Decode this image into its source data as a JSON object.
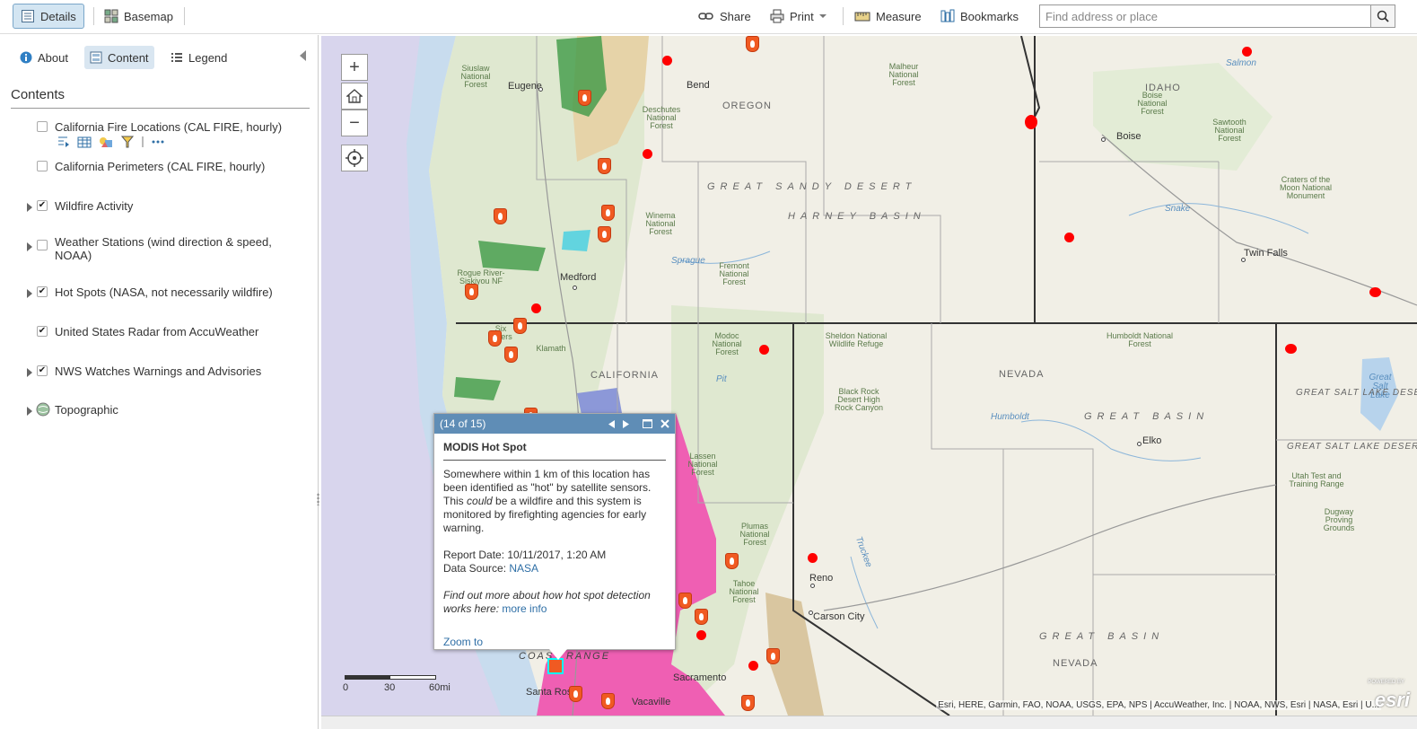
{
  "toolbar": {
    "details_label": "Details",
    "basemap_label": "Basemap",
    "share_label": "Share",
    "print_label": "Print",
    "measure_label": "Measure",
    "bookmarks_label": "Bookmarks",
    "search_placeholder": "Find address or place"
  },
  "panel": {
    "tabs": {
      "about": "About",
      "content": "Content",
      "legend": "Legend"
    },
    "contents_title": "Contents",
    "layers": [
      {
        "label": "California Fire Locations (CAL FIRE, hourly)",
        "checked": false
      },
      {
        "label": "California Perimeters (CAL FIRE, hourly)",
        "checked": false
      },
      {
        "label": "Wildfire Activity",
        "checked": true
      },
      {
        "label": "Weather Stations (wind direction & speed, NOAA)",
        "checked": false
      },
      {
        "label": "Hot Spots (NASA, not necessarily wildfire)",
        "checked": true
      },
      {
        "label": "United States Radar from AccuWeather",
        "checked": true
      },
      {
        "label": "NWS Watches Warnings and Advisories",
        "checked": true
      },
      {
        "label": "Topographic",
        "checked": false
      }
    ]
  },
  "map": {
    "labels": {
      "eugene": "Eugene",
      "bend": "Bend",
      "oregon": "OREGON",
      "medford": "Medford",
      "boise": "Boise",
      "idaho": "IDAHO",
      "twin_falls": "Twin Falls",
      "california": "CALIFORNIA",
      "nevada": "NEVADA",
      "elko": "Elko",
      "reno": "Reno",
      "carson_city": "Carson City",
      "sacramento": "Sacramento",
      "vacaville": "Vacaville",
      "santa_rosa": "Santa Rosa",
      "great_sandy_desert": "GREAT SANDY DESERT",
      "harney_basin": "HARNEY BASIN",
      "great_basin_1": "GREAT BASIN",
      "great_basin_2": "GREAT BASIN",
      "great_salt_lake_desert_1": "GREAT SALT LAKE DESERT",
      "great_salt_lake_desert_2": "GREAT SALT LAKE DESERT",
      "great_salt_lake": "Great Salt Lake",
      "coast_range": "COAST RANGE",
      "nevada_sub": "NEVADA",
      "deschutes": "Deschutes National Forest",
      "malheur": "Malheur National Forest",
      "winema": "Winema National Forest",
      "fremont": "Fremont National Forest",
      "modoc": "Modoc National Forest",
      "rogue": "Rogue River-Siskiyou NF",
      "siuslaw": "Siuslaw National Forest",
      "six_rivers": "Six Rivers",
      "klamath": "Klamath",
      "lassen": "Lassen National Forest",
      "plumas": "Plumas National Forest",
      "tahoe": "Tahoe National Forest",
      "sheldon": "Sheldon National Wildlife Refuge",
      "black_rock": "Black Rock Desert High Rock Canyon",
      "humboldt_nf": "Humboldt National Forest",
      "boise_nf": "Boise National Forest",
      "sawtooth": "Sawtooth National Forest",
      "craters": "Craters of the Moon National Monument",
      "utah_test": "Utah Test and Training Range",
      "dugway": "Dugway Proving Grounds",
      "humboldt_river": "Humboldt",
      "snake": "Snake",
      "salmon": "Salmon",
      "sprague": "Sprague",
      "pit": "Pit",
      "truckee": "Truckee"
    },
    "scalebar": {
      "t0": "0",
      "t1": "30",
      "t2": "60mi"
    },
    "attribution": "Esri, HERE, Garmin, FAO, NOAA, USGS, EPA, NPS | AccuWeather, Inc. | NOAA, NWS, Esri | NASA, Esri | U...",
    "logo": "esri",
    "powered": "POWERED BY"
  },
  "popup": {
    "counter": "(14 of 15)",
    "title": "MODIS Hot Spot",
    "desc_1": "Somewhere within 1 km of this location has been identified as \"hot\" by satellite sensors. This ",
    "desc_em": "could",
    "desc_2": " be a wildfire and this system is monitored by firefighting agencies for early warning.",
    "report_date": "Report Date: 10/11/2017, 1:20 AM",
    "data_source_label": "Data Source: ",
    "data_source_link": "NASA",
    "more_text": "Find out more about how hot spot detection works here: ",
    "more_link": "more info",
    "zoom_to": "Zoom to"
  }
}
